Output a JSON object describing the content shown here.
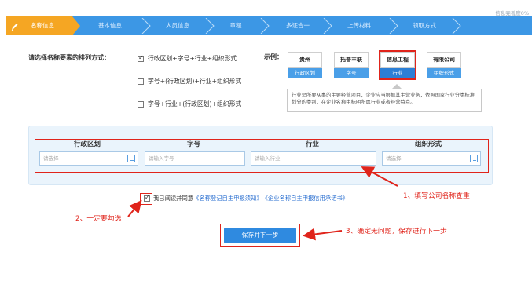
{
  "progress": {
    "text": "信息完善度0%"
  },
  "steps": [
    {
      "label": "名称信息",
      "active": true
    },
    {
      "label": "基本信息"
    },
    {
      "label": "人员信息"
    },
    {
      "label": "章程"
    },
    {
      "label": "多证合一"
    },
    {
      "label": "上传材料"
    },
    {
      "label": "领取方式"
    }
  ],
  "arrangement": {
    "label": "请选择名称要素的排列方式：",
    "options": [
      {
        "label": "行政区划+字号+行业+组织形式",
        "checked": true
      },
      {
        "label": "字号+(行政区划)+行业+组织形式",
        "checked": false
      },
      {
        "label": "字号+行业+(行政区划)+组织形式",
        "checked": false
      }
    ]
  },
  "example": {
    "label": "示例：",
    "items": [
      {
        "top": "贵州",
        "bottom": "行政区划"
      },
      {
        "top": "拓普丰联",
        "bottom": "字号"
      },
      {
        "top": "信息工程",
        "bottom": "行业",
        "highlight": true
      },
      {
        "top": "有限公司",
        "bottom": "组织形式"
      }
    ],
    "tip": "行业是所要从事的主要经营项目，企业应当根据其主营业务，依照国家行业分类标准划分的类别，在企业名称中标明所属行业或者经营特点。"
  },
  "fields": [
    {
      "header": "行政区划",
      "placeholder": "请选择",
      "has_icon": true
    },
    {
      "header": "字号",
      "placeholder": "请输入字号"
    },
    {
      "header": "行业",
      "placeholder": "请输入行业"
    },
    {
      "header": "组织形式",
      "placeholder": "请选择",
      "has_icon": true
    }
  ],
  "agreement": {
    "prefix": "我已阅读并同意",
    "link1": "《名称登记自主申报须知》",
    "link2": "《企业名称自主申报信用承诺书》",
    "checked": true
  },
  "submit": {
    "label": "保存并下一步"
  },
  "annotations": {
    "a1": "1、填写公司名称查重",
    "a2": "2、一定要勾选",
    "a3": "3、确定无问题，保存进行下一步"
  },
  "colors": {
    "primary": "#3c97e5",
    "active": "#f5a623",
    "annotation": "#e0241b",
    "link": "#2a6fd0"
  }
}
